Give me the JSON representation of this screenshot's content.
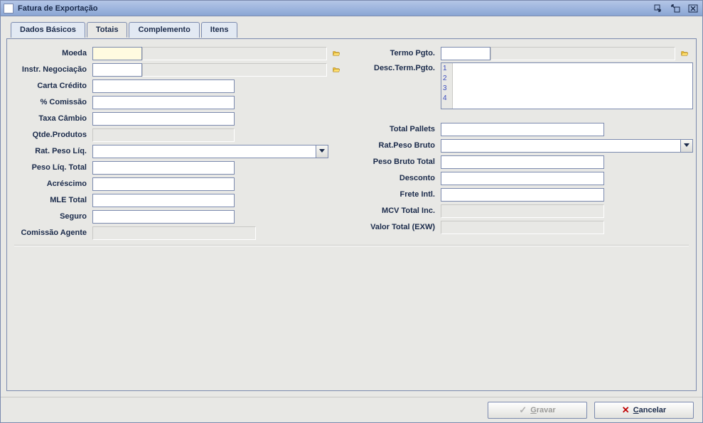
{
  "window": {
    "title": "Fatura de Exportação"
  },
  "tabs": {
    "t1": "Dados Básicos",
    "t2": "Totais",
    "t3": "Complemento",
    "t4": "Itens"
  },
  "labels": {
    "moeda": "Moeda",
    "instr_neg": "Instr. Negociação",
    "carta_credito": "Carta Crédito",
    "pct_comissao": "% Comissão",
    "taxa_cambio": "Taxa Câmbio",
    "qtde_produtos": "Qtde.Produtos",
    "rat_peso_liq": "Rat. Peso Líq.",
    "peso_liq_total": "Peso Líq. Total",
    "acrescimo": "Acréscimo",
    "mle_total": "MLE Total",
    "seguro": "Seguro",
    "comissao_agente": "Comissão Agente",
    "termo_pgto": "Termo Pgto.",
    "desc_term_pgto": "Desc.Term.Pgto.",
    "total_pallets": "Total Pallets",
    "rat_peso_bruto": "Rat.Peso Bruto",
    "peso_bruto_total": "Peso Bruto Total",
    "desconto": "Desconto",
    "frete_intl": "Frete Intl.",
    "mcv_total_inc": "MCV Total Inc.",
    "valor_total_exw": "Valor Total (EXW)"
  },
  "values": {
    "moeda_code": "",
    "moeda_desc": "",
    "instr_neg_code": "",
    "instr_neg_desc": "",
    "carta_credito": "",
    "pct_comissao": "",
    "taxa_cambio": "",
    "qtde_produtos": "",
    "rat_peso_liq": "",
    "peso_liq_total": "",
    "acrescimo": "",
    "mle_total": "",
    "seguro": "",
    "comissao_agente": "",
    "termo_pgto_code": "",
    "termo_pgto_desc": "",
    "desc_term_pgto": "",
    "total_pallets": "",
    "rat_peso_bruto": "",
    "peso_bruto_total": "",
    "desconto": "",
    "frete_intl": "",
    "mcv_total_inc": "",
    "valor_total_exw": ""
  },
  "desc_lines": {
    "l1": "1",
    "l2": "2",
    "l3": "3",
    "l4": "4"
  },
  "buttons": {
    "gravar_prefix": "G",
    "gravar_rest": "ravar",
    "cancelar_prefix": "C",
    "cancelar_rest": "ancelar"
  }
}
